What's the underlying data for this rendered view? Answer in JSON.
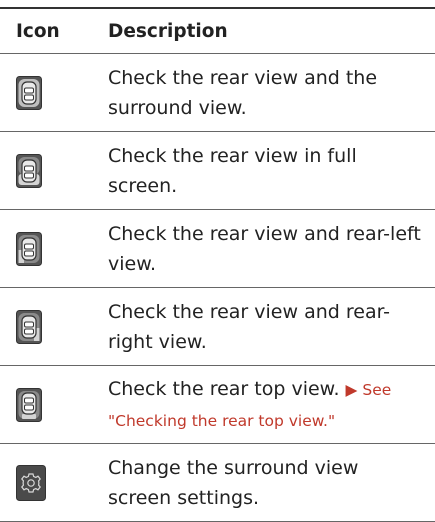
{
  "table": {
    "header": {
      "icon_col": "Icon",
      "desc_col": "Description"
    },
    "rows": [
      {
        "icon": "rear-surround-view-icon",
        "description": "Check the rear view and the surround view."
      },
      {
        "icon": "rear-full-screen-view-icon",
        "description": "Check the rear view in full screen."
      },
      {
        "icon": "rear-left-view-icon",
        "description": "Check the rear view and rear-left view."
      },
      {
        "icon": "rear-right-view-icon",
        "description": "Check the rear view and rear-right view."
      },
      {
        "icon": "rear-top-view-icon",
        "description": "Check the rear top view. ",
        "see_ref": "▶ See \"Checking the rear top view.\""
      },
      {
        "icon": "settings-gear-icon",
        "description": "Change the surround view screen settings."
      }
    ]
  },
  "colors": {
    "link": "#c0392b",
    "icon_bg": "#4a4a4a",
    "icon_highlight": "#d9d9d9"
  }
}
